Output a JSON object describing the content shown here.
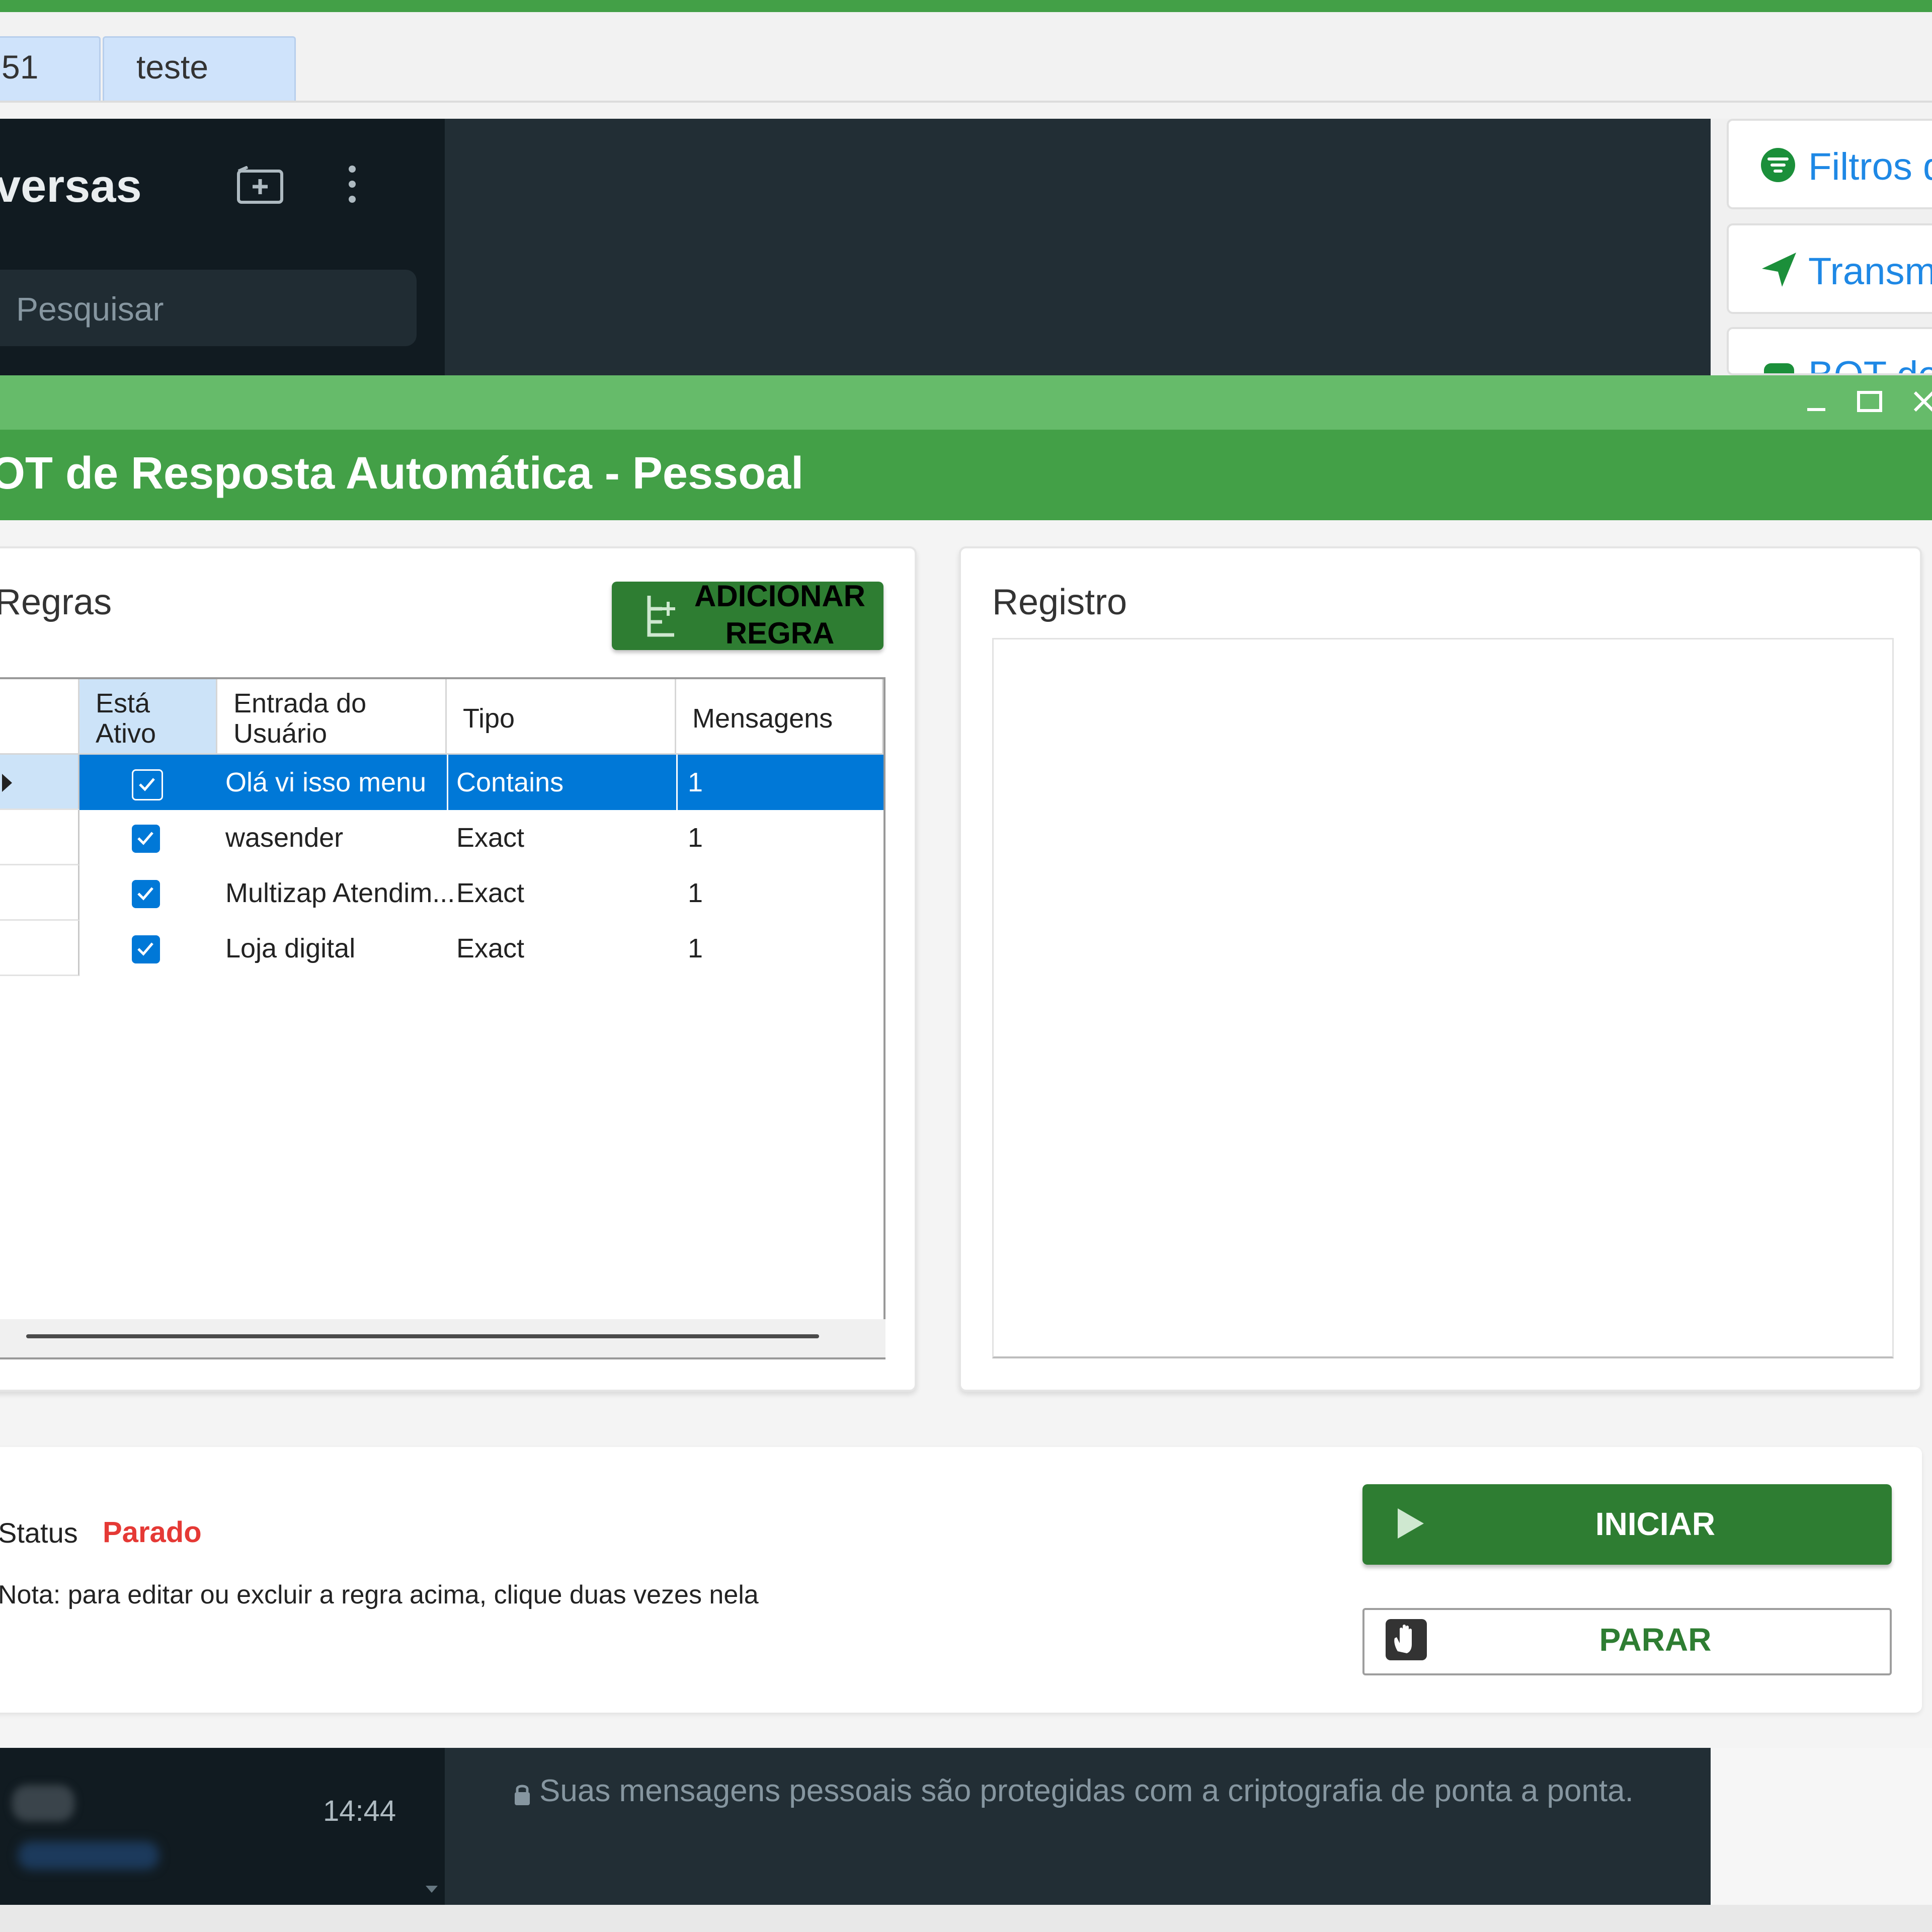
{
  "browser_tabs": [
    "51",
    "teste"
  ],
  "whatsapp": {
    "sidebar_title": "versas",
    "search_placeholder": "Pesquisar",
    "chat_time": "14:44",
    "encryption_notice": "Suas mensagens pessoais são protegidas com a criptografia de ponta a ponta."
  },
  "right_panel": {
    "filters_label": "Filtros d",
    "transmit_label": "Transmi",
    "bot_label": "BOT de"
  },
  "dialog": {
    "title": "OT de Resposta Automática - Pessoal",
    "rules_title": "Regras",
    "add_rule_line1": "ADICIONAR",
    "add_rule_line2": "REGRA",
    "log_title": "Registro",
    "columns": {
      "active_line1": "Está",
      "active_line2": "Ativo",
      "input_line1": "Entrada do",
      "input_line2": "Usuário",
      "type": "Tipo",
      "messages": "Mensagens"
    },
    "rows": [
      {
        "active": true,
        "input": "Olá vi isso menu",
        "type": "Contains",
        "messages": "1",
        "selected": true
      },
      {
        "active": true,
        "input": "wasender",
        "type": "Exact",
        "messages": "1",
        "selected": false
      },
      {
        "active": true,
        "input": "Multizap Atendim...",
        "type": "Exact",
        "messages": "1",
        "selected": false
      },
      {
        "active": true,
        "input": "Loja digital",
        "type": "Exact",
        "messages": "1",
        "selected": false
      }
    ],
    "status_label": "Status",
    "status_value": "Parado",
    "note": "Nota: para editar ou excluir a regra acima, clique duas vezes nela",
    "start_label": "INICIAR",
    "stop_label": "PARAR"
  },
  "colors": {
    "accent_green": "#43a047",
    "dark_green": "#2e7d32",
    "selection_blue": "#0078d7",
    "status_red": "#e53935"
  },
  "icons": [
    "new-chat-icon",
    "menu-icon",
    "filter-icon",
    "send-icon",
    "bot-icon",
    "minimize-icon",
    "maximize-icon",
    "close-icon",
    "add-rule-icon",
    "play-icon",
    "hand-stop-icon",
    "lock-icon"
  ]
}
